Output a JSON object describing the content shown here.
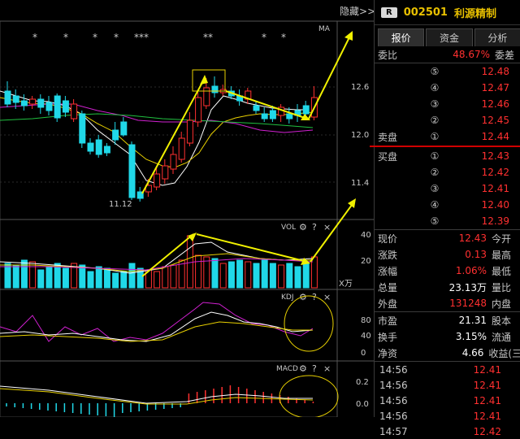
{
  "chart": {
    "hide_label": "隐藏",
    "hide_arrow": ">>",
    "ma_label": "MA",
    "y_labels": [
      "12.6",
      "12.0",
      "11.4"
    ],
    "low_label": "11.12",
    "stars": [
      "*",
      "*",
      "*",
      "*",
      "***",
      "**",
      "*",
      "*"
    ],
    "vol": {
      "title": "VOL",
      "y_labels": [
        "40",
        "20"
      ],
      "unit": "X万"
    },
    "kdj": {
      "title": "KDJ",
      "y_labels": [
        "80",
        "40",
        "0"
      ]
    },
    "macd": {
      "title": "MACD",
      "y_labels": [
        "0.2",
        "0.0"
      ]
    },
    "gear_glyph": "⚙",
    "help_glyph": "?",
    "close_glyph": "×"
  },
  "panel": {
    "badge": "R",
    "code": "002501",
    "name": "利源精制",
    "tabs": [
      {
        "label": "报价"
      },
      {
        "label": "资金"
      },
      {
        "label": "分析"
      }
    ],
    "ratio": {
      "label": "委比",
      "value": "48.67%",
      "label2": "委差"
    },
    "sell": [
      {
        "label": "",
        "level": "⑤",
        "price": "12.48"
      },
      {
        "label": "",
        "level": "④",
        "price": "12.47"
      },
      {
        "label": "",
        "level": "③",
        "price": "12.46"
      },
      {
        "label": "",
        "level": "②",
        "price": "12.45"
      },
      {
        "label": "卖盘",
        "level": "①",
        "price": "12.44"
      }
    ],
    "buy": [
      {
        "label": "买盘",
        "level": "①",
        "price": "12.43"
      },
      {
        "label": "",
        "level": "②",
        "price": "12.42"
      },
      {
        "label": "",
        "level": "③",
        "price": "12.41"
      },
      {
        "label": "",
        "level": "④",
        "price": "12.40"
      },
      {
        "label": "",
        "level": "⑤",
        "price": "12.39"
      }
    ],
    "quote1": [
      {
        "label": "现价",
        "value": "12.43",
        "label2": "今开"
      },
      {
        "label": "涨跌",
        "value": "0.13",
        "label2": "最高"
      },
      {
        "label": "涨幅",
        "value": "1.06%",
        "label2": "最低"
      },
      {
        "label": "总量",
        "value": "23.13万",
        "label2": "量比"
      },
      {
        "label": "外盘",
        "value": "131248",
        "label2": "内盘"
      }
    ],
    "quote2": [
      {
        "label": "市盈",
        "value": "21.31",
        "label2": "股本"
      },
      {
        "label": "换手",
        "value": "3.15%",
        "label2": "流通"
      },
      {
        "label": "净资",
        "value": "4.66",
        "label2": "收益(三"
      }
    ],
    "trades": [
      {
        "time": "14:56",
        "price": "12.41"
      },
      {
        "time": "14:56",
        "price": "12.41"
      },
      {
        "time": "14:56",
        "price": "12.41"
      },
      {
        "time": "14:56",
        "price": "12.41"
      },
      {
        "time": "14:57",
        "price": "12.42"
      }
    ]
  }
}
